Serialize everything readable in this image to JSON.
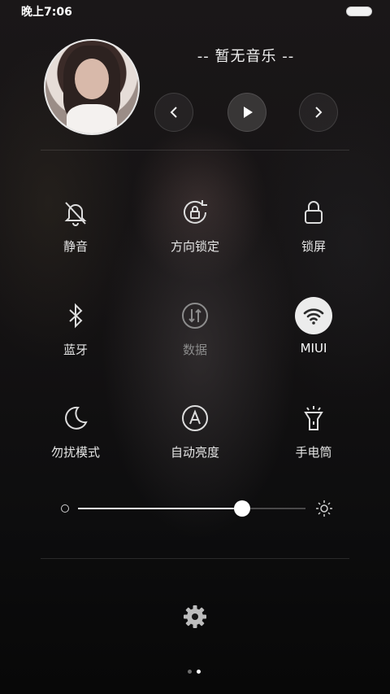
{
  "status_bar": {
    "time": "晚上7:06"
  },
  "music": {
    "title": "-- 暂无音乐 --",
    "controls": [
      "previous-icon",
      "play-icon",
      "next-icon"
    ]
  },
  "tiles": [
    {
      "label": "静音",
      "icon": "mute-bell-icon",
      "state": "off"
    },
    {
      "label": "方向锁定",
      "icon": "rotation-lock-icon",
      "state": "off"
    },
    {
      "label": "锁屏",
      "icon": "lock-icon",
      "state": "off"
    },
    {
      "label": "蓝牙",
      "icon": "bluetooth-icon",
      "state": "off"
    },
    {
      "label": "数据",
      "icon": "mobile-data-icon",
      "state": "disabled"
    },
    {
      "label": "MIUI",
      "icon": "wifi-icon",
      "state": "on"
    },
    {
      "label": "勿扰模式",
      "icon": "moon-icon",
      "state": "off"
    },
    {
      "label": "自动亮度",
      "icon": "auto-brightness-icon",
      "state": "off"
    },
    {
      "label": "手电筒",
      "icon": "flashlight-icon",
      "state": "off"
    }
  ],
  "brightness": {
    "level": 0.72
  },
  "pager": {
    "pages": 2,
    "active": 2
  },
  "colors": {
    "active_tile": "#ececec",
    "accent_dot": "#ffffff",
    "inactive_dot": "#6e6e6e"
  }
}
